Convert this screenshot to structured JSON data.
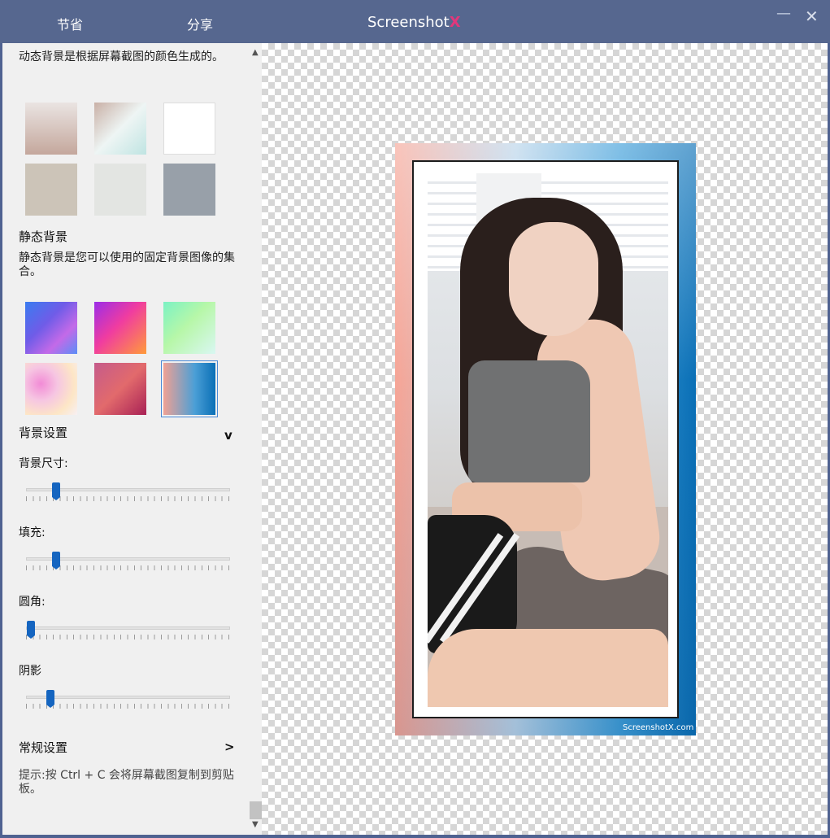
{
  "titlebar": {
    "save_label": "节省",
    "share_label": "分享",
    "app_title_prefix": "Screenshot",
    "app_title_suffix": "X",
    "minimize_icon": "minimize-icon",
    "close_icon": "close-icon"
  },
  "panel": {
    "dynamic_desc": "动态背景是根据屏幕截图的颜色生成的。",
    "static_heading": "静态背景",
    "static_desc": "静态背景是您可以使用的固定背景图像的集合。",
    "bg_settings_label": "背景设置",
    "bg_settings_chevron": "v",
    "bg_size_label": "背景尺寸:",
    "padding_label": "填充:",
    "radius_label": "圆角:",
    "shadow_label": "阴影",
    "general_settings_label": "常规设置",
    "general_settings_chevron": ">",
    "tip_text": "提示:按 Ctrl + C 会将屏幕截图复制到剪贴板。"
  },
  "sliders": {
    "bg_size": 0.15,
    "padding": 0.15,
    "radius": 0.0,
    "shadow": 0.12
  },
  "dynamic_swatches": [
    "#c8b1a9",
    "#d8ece9",
    "#ffffff",
    "#ccc4b8",
    "#e3e5e2",
    "#98a0a9"
  ],
  "static_swatches": [
    "gradient-blue-violet",
    "gradient-magenta-orange",
    "gradient-green-aqua",
    "gradient-pink-bokeh",
    "gradient-red-triangles",
    "gradient-blue-salmon"
  ],
  "preview": {
    "watermark_text": "ScreenshotX.com"
  }
}
